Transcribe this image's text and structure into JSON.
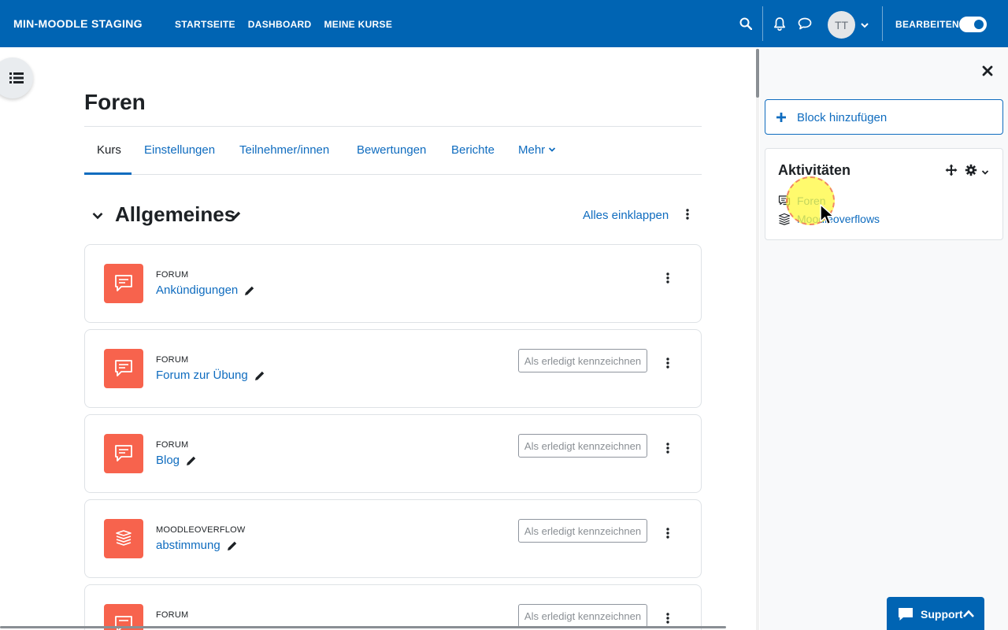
{
  "navbar": {
    "brand": "MIN-MOODLE STAGING",
    "links": [
      "STARTSEITE",
      "DASHBOARD",
      "MEINE KURSE"
    ],
    "avatar_initials": "TT",
    "edit_label": "BEARBEITEN",
    "edit_mode_on": true
  },
  "page": {
    "title": "Foren"
  },
  "tabs": [
    "Kurs",
    "Einstellungen",
    "Teilnehmer/innen",
    "Bewertungen",
    "Berichte",
    "Mehr"
  ],
  "active_tab": "Kurs",
  "section": {
    "title": "Allgemeines",
    "collapse_all": "Alles einklappen"
  },
  "activities": [
    {
      "type": "FORUM",
      "name": "Ankündigungen",
      "completion": ""
    },
    {
      "type": "FORUM",
      "name": "Forum zur Übung",
      "completion": "Als erledigt kennzeichnen"
    },
    {
      "type": "FORUM",
      "name": "Blog",
      "completion": "Als erledigt kennzeichnen"
    },
    {
      "type": "MOODLEOVERFLOW",
      "name": "abstimmung",
      "completion": "Als erledigt kennzeichnen"
    },
    {
      "type": "FORUM",
      "name": "",
      "completion": "Als erledigt kennzeichnen"
    }
  ],
  "drawer": {
    "add_block": "Block hinzufügen",
    "block_title": "Aktivitäten",
    "items": [
      "Foren",
      "Moodleoverflows"
    ]
  },
  "support": {
    "label": "Support"
  },
  "colors": {
    "navbar": "#0064b3",
    "link": "#0f6cbf",
    "activity_icon": "#f7634d"
  }
}
